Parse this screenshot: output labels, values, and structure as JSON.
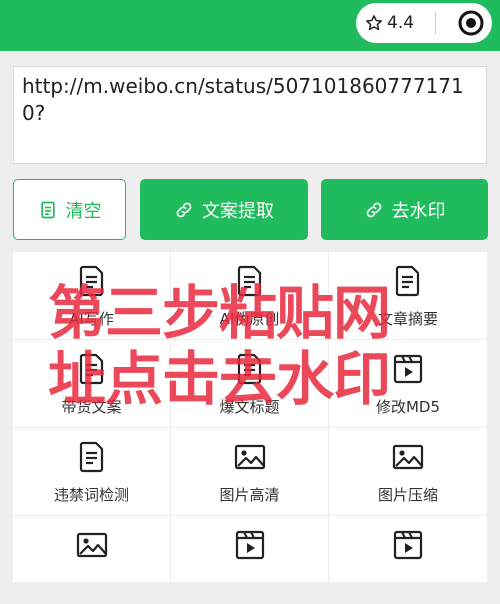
{
  "header": {
    "rating": "4.4",
    "accent_color": "#1fbb5d"
  },
  "url_input": {
    "value": "http://m.weibo.cn/status/5071018607771710?"
  },
  "buttons": {
    "clear": "清空",
    "extract": "文案提取",
    "watermark": "去水印"
  },
  "tools": [
    {
      "label": "AI写作",
      "icon": "document-icon"
    },
    {
      "label": "AI伪原创",
      "icon": "document-icon"
    },
    {
      "label": "文章摘要",
      "icon": "document-icon"
    },
    {
      "label": "带货文案",
      "icon": "document-icon"
    },
    {
      "label": "爆文标题",
      "icon": "document-icon"
    },
    {
      "label": "修改MD5",
      "icon": "video-icon"
    },
    {
      "label": "违禁词检测",
      "icon": "document-icon"
    },
    {
      "label": "图片高清",
      "icon": "image-icon"
    },
    {
      "label": "图片压缩",
      "icon": "image-icon"
    },
    {
      "label": "",
      "icon": "image-icon"
    },
    {
      "label": "",
      "icon": "video-icon"
    },
    {
      "label": "",
      "icon": "video-icon"
    }
  ],
  "overlay_text": {
    "line1": "第三步粘贴网",
    "line2": "址点击去水印",
    "color": "#e8283c"
  }
}
